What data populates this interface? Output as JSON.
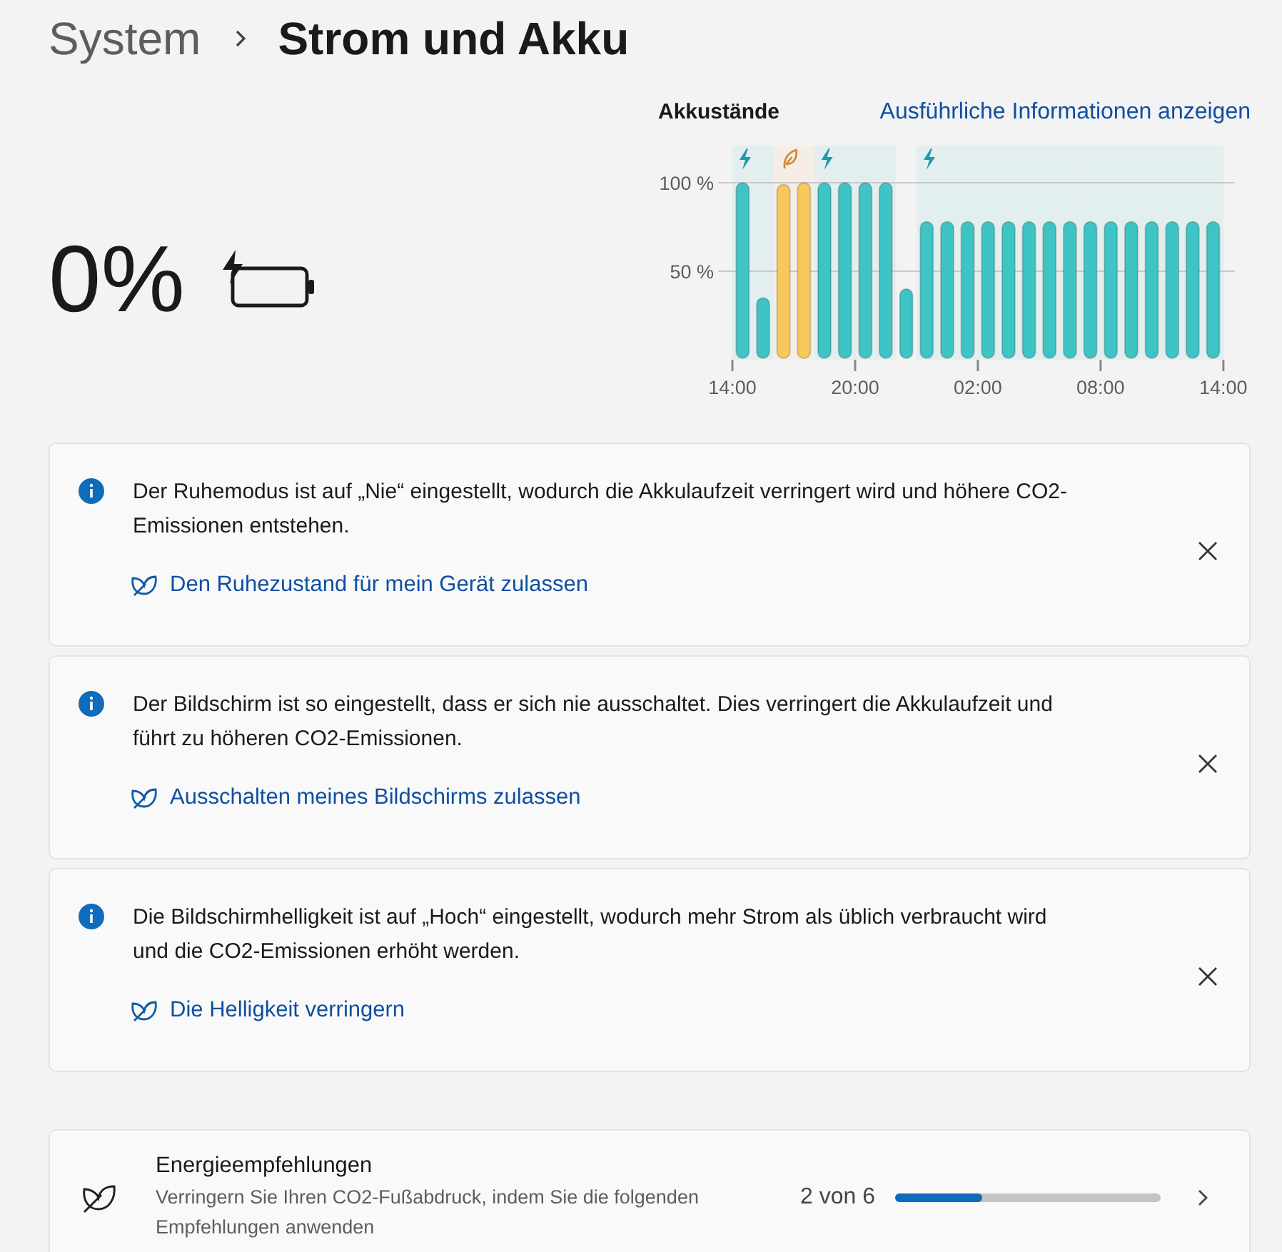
{
  "header": {
    "parent": "System",
    "title": "Strom und Akku"
  },
  "battery": {
    "percent": "0%",
    "charging": true
  },
  "history": {
    "title": "Akkustände",
    "link": "Ausführliche Informationen anzeigen",
    "hours": [
      {
        "kind": "charging"
      },
      {
        "kind": "charging"
      },
      {
        "kind": "saver"
      },
      {
        "kind": "saver"
      },
      {
        "kind": "charging"
      },
      {
        "kind": "charging"
      },
      {
        "kind": "charging"
      },
      {
        "kind": "charging"
      },
      {
        "kind": "none"
      },
      {
        "kind": "charging"
      },
      {
        "kind": "charging"
      },
      {
        "kind": "charging"
      },
      {
        "kind": "charging"
      },
      {
        "kind": "charging"
      },
      {
        "kind": "charging"
      },
      {
        "kind": "charging"
      },
      {
        "kind": "charging"
      },
      {
        "kind": "charging"
      },
      {
        "kind": "charging"
      },
      {
        "kind": "charging"
      },
      {
        "kind": "charging"
      },
      {
        "kind": "charging"
      },
      {
        "kind": "charging"
      },
      {
        "kind": "charging"
      }
    ],
    "axis_end_label": "14:00",
    "chart_data": {
      "type": "bar",
      "categories": [
        "14:00",
        null,
        null,
        null,
        null,
        null,
        "20:00",
        null,
        null,
        null,
        null,
        null,
        "02:00",
        null,
        null,
        null,
        null,
        null,
        "08:00",
        null,
        null,
        null,
        null,
        null
      ],
      "ylim": [
        0,
        100
      ],
      "yticks": [
        {
          "value": 50,
          "label": "50 %"
        },
        {
          "value": 100,
          "label": "100 %"
        }
      ],
      "series": [
        {
          "color": "#3fc4c6",
          "values": [
            100,
            35,
            null,
            null,
            100,
            100,
            100,
            100,
            40,
            78,
            78,
            78,
            78,
            78,
            78,
            78,
            78,
            78,
            78,
            78,
            78,
            78,
            78,
            78
          ]
        },
        {
          "color": "#f7c85a",
          "values": [
            null,
            null,
            99,
            100,
            null,
            null,
            null,
            null,
            null,
            null,
            null,
            null,
            null,
            null,
            null,
            null,
            null,
            null,
            null,
            null,
            null,
            null,
            null,
            null
          ]
        }
      ]
    }
  },
  "notices": [
    {
      "text": "Der Ruhemodus ist auf „Nie“ eingestellt, wodurch die Akkulaufzeit verringert wird und höhere CO2-Emissionen entstehen.",
      "link": "Den Ruhezustand für mein Gerät zulassen"
    },
    {
      "text": "Der Bildschirm ist so eingestellt, dass er sich nie ausschaltet. Dies verringert die Akkulaufzeit und führt zu höheren CO2-Emissionen.",
      "link": "Ausschalten meines Bildschirms zulassen"
    },
    {
      "text": "Die Bildschirmhelligkeit ist auf „Hoch“ eingestellt, wodurch mehr Strom als üblich verbraucht wird und die CO2-Emissionen erhöht werden.",
      "link": "Die Helligkeit verringern"
    }
  ],
  "recommendations": {
    "title": "Energieempfehlungen",
    "description": "Verringern Sie Ihren CO2-Fußabdruck, indem Sie die folgenden Empfehlungen anwenden",
    "count": "2 von 6",
    "level": 0.33
  }
}
